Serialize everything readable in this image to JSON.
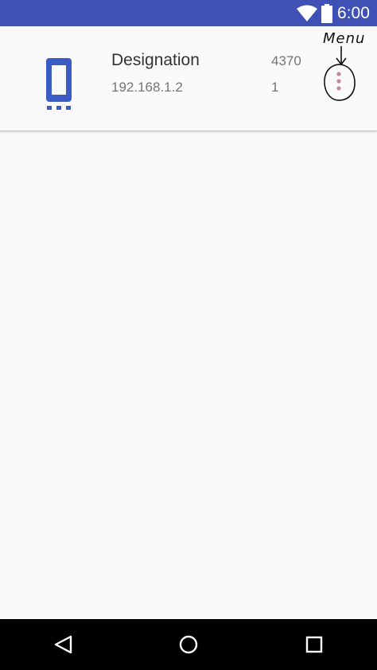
{
  "status_bar": {
    "time": "6:00",
    "icons": [
      "wifi-icon",
      "battery-icon"
    ],
    "background_color": "#3f51b5"
  },
  "device_list": {
    "items": [
      {
        "icon": "phone-icon",
        "icon_color": "#3f51b5",
        "name": "Designation",
        "ip": "192.168.1.2",
        "port": "4370",
        "count": "1",
        "menu_icon": "more-vert-icon"
      }
    ]
  },
  "annotation": {
    "text": "Menu"
  },
  "nav_bar": {
    "buttons": [
      "back-icon",
      "home-icon",
      "recent-apps-icon"
    ]
  }
}
